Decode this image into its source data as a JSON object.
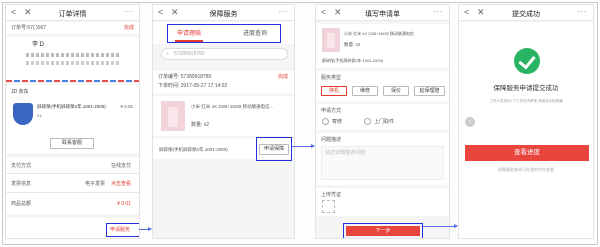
{
  "panel1": {
    "title": "订单详情",
    "order_no": "订单号:57(          )067",
    "status": "完成",
    "recipient": "李        D",
    "jd_store": "JD 京东",
    "product_name": "屏碎保(手机屏碎保2年,1001-2000)",
    "product_price": "¥ 0.01",
    "product_qty": "x1",
    "service_btn": "联系客服",
    "rows": [
      {
        "label": "支付方式",
        "value": "在线支付"
      },
      {
        "label": "发票信息",
        "value": "电子发票",
        "extra": "点击查看"
      },
      {
        "label": "商品总额",
        "value": "¥ 0.01"
      }
    ],
    "apply_btn": "申请服务"
  },
  "panel2": {
    "title": "保障服务",
    "tab_apply": "申请理赔",
    "tab_progress": "进度查询",
    "search_placeholder": "57389918780",
    "order_no": "订单编号: 57389918780",
    "order_time": "下单时间: 2017-05-27 17:14:02",
    "order_status": "完成",
    "product_name": "小米 红米 4X 2GB+16GB 移动联通电信...",
    "qty": "数量: x2",
    "item": "屏碎保(手机屏碎保2年,1001-2000)",
    "apply_btn": "申请保障"
  },
  "panel3": {
    "title": "填写申请单",
    "product_name": "小米 红米 4X 2GB+16GB 移动联通电信",
    "qty": "数量: x2",
    "item": "屏碎保(手机屏碎保2年,1001-2000)",
    "service_type_label": "服务类型",
    "types": [
      "换机",
      "维修",
      "保价",
      "延保理赔"
    ],
    "apply_method_label": "申请方式",
    "methods": [
      "寄修",
      "上门取件"
    ],
    "desc_label": "问题描述",
    "desc_placeholder": "请您详细描述问题",
    "upload_label": "上传凭证",
    "submit_btn": "下一步"
  },
  "panel4": {
    "title": "提交成功",
    "success_text": "保障服务申请提交成功",
    "sub_text": "工作人员将在1个工作日内审核,请保持手机畅通",
    "view_btn": "查看进度",
    "footer": "保障服务查询可在我的京东查看"
  }
}
